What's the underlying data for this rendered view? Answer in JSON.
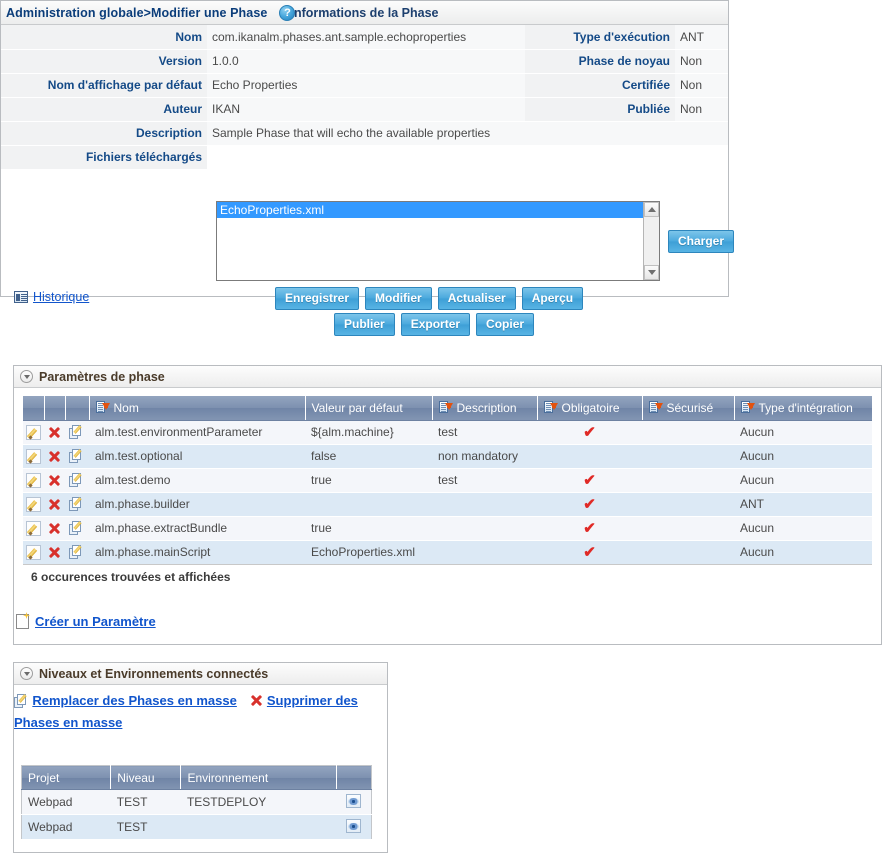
{
  "breadcrumb": {
    "text": "Administration globale>Modifier une Phase",
    "help_icon": "help-icon",
    "help_label": "?"
  },
  "phase_info": {
    "title": "Informations de la Phase",
    "fields": {
      "nom_label": "Nom",
      "nom_value": "com.ikanalm.phases.ant.sample.echoproperties",
      "type_exec_label": "Type d'exécution",
      "type_exec_value": "ANT",
      "version_label": "Version",
      "version_value": "1.0.0",
      "phase_noyau_label": "Phase de noyau",
      "phase_noyau_value": "Non",
      "nom_affichage_label": "Nom d'affichage par défaut",
      "nom_affichage_value": "Echo Properties",
      "certifiee_label": "Certifiée",
      "certifiee_value": "Non",
      "auteur_label": "Auteur",
      "auteur_value": "IKAN",
      "publiee_label": "Publiée",
      "publiee_value": "Non",
      "description_label": "Description",
      "description_value": "Sample Phase that will echo the available properties",
      "fichiers_label": "Fichiers téléchargés"
    },
    "file_list": {
      "selected_file": "EchoProperties.xml"
    },
    "charger_label": "Charger",
    "history_label": "Historique",
    "buttons_row1": [
      "Enregistrer",
      "Modifier",
      "Actualiser",
      "Aperçu"
    ],
    "buttons_row2": [
      "Publier",
      "Exporter",
      "Copier"
    ]
  },
  "params_panel": {
    "title": "Paramètres de phase",
    "columns": [
      "",
      "",
      "",
      "Nom",
      "Valeur par défaut",
      "Description",
      "Obligatoire",
      "Sécurisé",
      "Type d'intégration"
    ],
    "rows": [
      {
        "nom": "alm.test.environmentParameter",
        "valeur": "${alm.machine}",
        "description": "test",
        "obligatoire": "✔",
        "securise": "",
        "type_integration": "Aucun"
      },
      {
        "nom": "alm.test.optional",
        "valeur": "false",
        "description": "non mandatory",
        "obligatoire": "",
        "securise": "",
        "type_integration": "Aucun"
      },
      {
        "nom": "alm.test.demo",
        "valeur": "true",
        "description": "test",
        "obligatoire": "✔",
        "securise": "",
        "type_integration": "Aucun"
      },
      {
        "nom": "alm.phase.builder",
        "valeur": "",
        "description": "",
        "obligatoire": "✔",
        "securise": "",
        "type_integration": "ANT"
      },
      {
        "nom": "alm.phase.extractBundle",
        "valeur": "true",
        "description": "",
        "obligatoire": "✔",
        "securise": "",
        "type_integration": "Aucun"
      },
      {
        "nom": "alm.phase.mainScript",
        "valeur": "EchoProperties.xml",
        "description": "",
        "obligatoire": "✔",
        "securise": "",
        "type_integration": "Aucun"
      }
    ],
    "count_text": "6 occurences trouvées et affichées",
    "create_param_label": "Créer un Paramètre"
  },
  "levels_panel": {
    "title": "Niveaux et Environnements connectés",
    "replace_link": "Remplacer des Phases en masse",
    "delete_link": "Supprimer des Phases en masse",
    "columns": [
      "Projet",
      "Niveau",
      "Environnement",
      ""
    ],
    "rows": [
      {
        "projet": "Webpad",
        "niveau": "TEST",
        "environnement": "TESTDEPLOY"
      },
      {
        "projet": "Webpad",
        "niveau": "TEST",
        "environnement": ""
      }
    ]
  },
  "colors": {
    "link": "#1155cc",
    "label": "#144a87",
    "button": "#49a8dd",
    "header": "#7d91b0",
    "check": "#e02a26",
    "row_odd": "#f4f6fa",
    "row_even": "#dce9f5"
  }
}
